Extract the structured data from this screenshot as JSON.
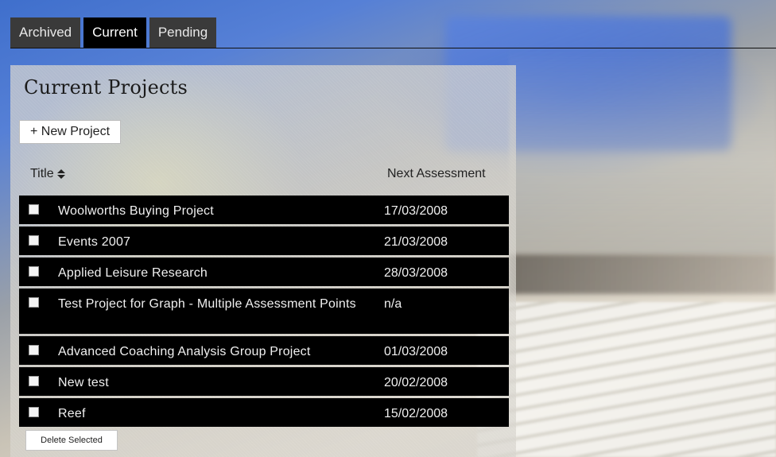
{
  "tabs": [
    {
      "label": "Archived",
      "active": false
    },
    {
      "label": "Current",
      "active": true
    },
    {
      "label": "Pending",
      "active": false
    }
  ],
  "page": {
    "title": "Current Projects",
    "new_button": "+ New Project",
    "delete_button": "Delete Selected"
  },
  "table": {
    "columns": {
      "title": "Title",
      "next_assessment": "Next Assessment"
    },
    "rows": [
      {
        "title": "Woolworths Buying Project",
        "date": "17/03/2008",
        "checked": false
      },
      {
        "title": "Events 2007",
        "date": "21/03/2008",
        "checked": false
      },
      {
        "title": "Applied Leisure Research",
        "date": "28/03/2008",
        "checked": false
      },
      {
        "title": "Test Project for Graph - Multiple Assessment Points",
        "date": "n/a",
        "checked": false
      },
      {
        "title": "Advanced Coaching Analysis Group Project",
        "date": "01/03/2008",
        "checked": false
      },
      {
        "title": "New test",
        "date": "20/02/2008",
        "checked": false
      },
      {
        "title": "Reef",
        "date": "15/02/2008",
        "checked": false
      }
    ]
  },
  "icons": {
    "sort": "sort-updown-icon"
  },
  "colors": {
    "tab_active": "#000000",
    "tab_inactive": "#3a3a3a",
    "row_bg": "#000000"
  }
}
